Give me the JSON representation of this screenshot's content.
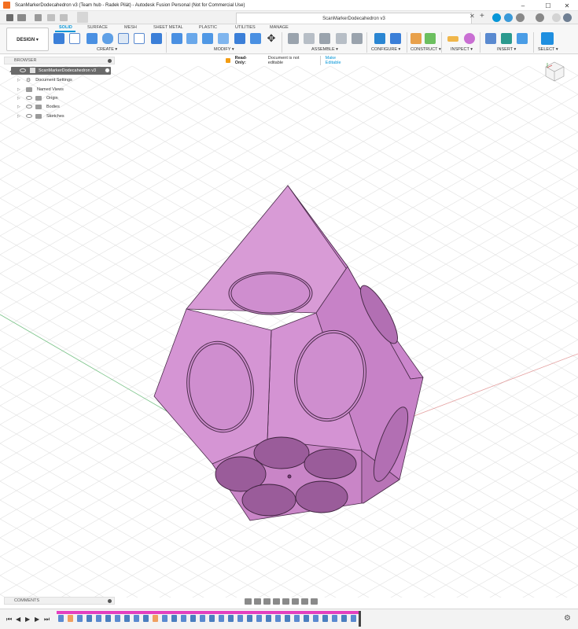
{
  "window": {
    "title": "ScanMarkerDodecahedron v3 (Team hub - Radek Pilát) - Autodesk Fusion Personal (Not for Commercial Use)",
    "controls": [
      "minimize",
      "maximize",
      "close"
    ]
  },
  "doc_tab": {
    "label": "ScanMarkerDodecahedron v3"
  },
  "toolbar": {
    "workspace_button": "DESIGN ▾",
    "tabs": [
      "SOLID",
      "SURFACE",
      "MESH",
      "SHEET METAL",
      "PLASTIC",
      "UTILITIES",
      "MANAGE"
    ],
    "active_tab": "SOLID",
    "groups": [
      "CREATE ▾",
      "MODIFY ▾",
      "ASSEMBLE ▾",
      "CONFIGURE ▾",
      "CONSTRUCT ▾",
      "INSPECT ▾",
      "INSERT ▾",
      "SELECT ▾"
    ]
  },
  "browser": {
    "header": "BROWSER",
    "root": "ScanMarkerDodecahedron v3",
    "items": [
      {
        "label": "Document Settings",
        "icon": "gear-icon"
      },
      {
        "label": "Named Views",
        "icon": "folder-icon"
      },
      {
        "label": "Origin",
        "icon": "folder-icon"
      },
      {
        "label": "Bodies",
        "icon": "folder-icon"
      },
      {
        "label": "Sketches",
        "icon": "folder-icon"
      }
    ]
  },
  "banner": {
    "status": "Read-Only:",
    "message": "Document is not editable",
    "action": "Make Editable"
  },
  "comments": {
    "label": "COMMENTS"
  },
  "colors": {
    "accent": "#0696d7",
    "model_fill": "#d58fd6",
    "timeline_bar": "#e43fbf"
  }
}
